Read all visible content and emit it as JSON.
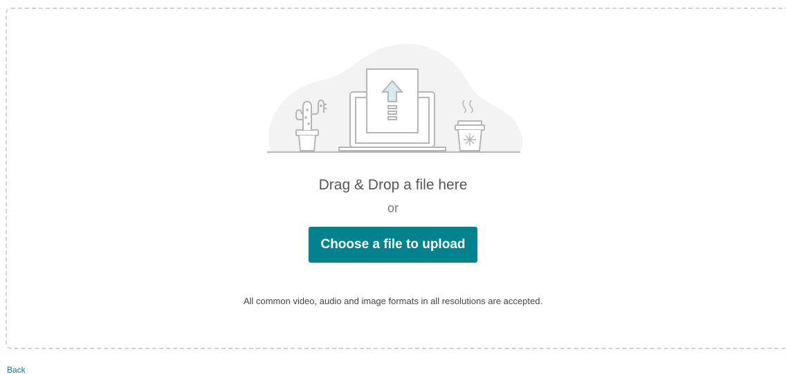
{
  "dropzone": {
    "drag_text": "Drag & Drop a file here",
    "or_text": "or",
    "upload_button_label": "Choose a file to upload",
    "formats_text": "All common video, audio and image formats in all resolutions are accepted."
  },
  "illustration": {
    "icons": [
      "cactus-icon",
      "laptop-icon",
      "upload-document-icon",
      "upload-arrow-icon",
      "coffee-cup-icon",
      "steam-icon"
    ]
  },
  "footer": {
    "back_label": "Back"
  },
  "colors": {
    "accent": "#00838f",
    "dashed_border": "#d2d2d2",
    "illustration_stroke": "#b5b5b5",
    "illustration_blob": "#f3f3f3",
    "arrow_fill": "#d6ecf3"
  }
}
